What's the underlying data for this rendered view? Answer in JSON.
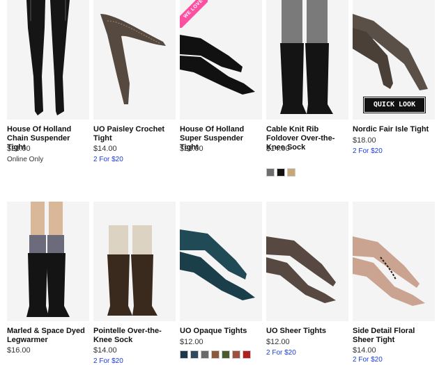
{
  "products": [
    {
      "name": "House Of Holland Chain Suspender Tight",
      "price": "$28.00",
      "note": "Online Only"
    },
    {
      "name": "UO Paisley Crochet Tight",
      "price": "$14.00",
      "promo": "2 For $20"
    },
    {
      "name": "House Of Holland Super Suspender Tight",
      "price": "$28.00",
      "badge": "WE LOVE"
    },
    {
      "name": "Cable Knit Rib Foldover Over-the-Knee Sock",
      "price": "$14.00",
      "swatches": [
        "#6e6e6e",
        "#111111",
        "#c8a77a"
      ]
    },
    {
      "name": "Nordic Fair Isle Tight",
      "price": "$18.00",
      "promo": "2 For $20",
      "quick_look": "QUICK LOOK"
    },
    {
      "name": "Marled & Space Dyed Legwarmer",
      "price": "$16.00"
    },
    {
      "name": "Pointelle Over-the-Knee Sock",
      "price": "$14.00",
      "promo": "2 For $20"
    },
    {
      "name": "UO Opaque Tights",
      "price": "$12.00",
      "swatches": [
        "#1e3a4a",
        "#2d4a5e",
        "#6a6a6a",
        "#8a5a3a",
        "#4a5a2a",
        "#a05040",
        "#b02020"
      ]
    },
    {
      "name": "UO Sheer Tights",
      "price": "$12.00",
      "promo": "2 For $20"
    },
    {
      "name": "Side Detail Floral Sheer Tight",
      "price": "$14.00",
      "promo": "2 For $20"
    }
  ]
}
